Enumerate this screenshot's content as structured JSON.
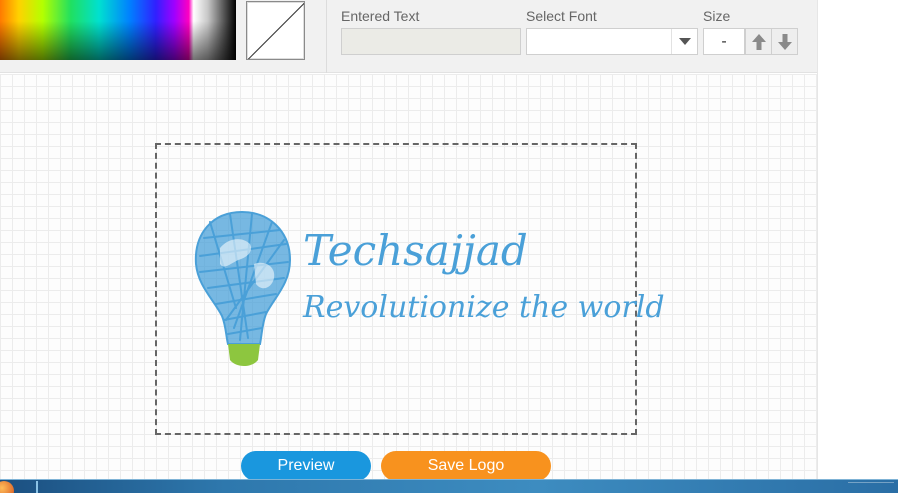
{
  "toolbar": {
    "entered_text_label": "Entered Text",
    "entered_text_value": "",
    "select_font_label": "Select Font",
    "select_font_value": "",
    "size_label": "Size",
    "size_value": "-"
  },
  "logo": {
    "title": "Techsajjad",
    "tagline": "Revolutionize the world",
    "text_color": "#4aa0d8",
    "bulb_color": "#4aa0d8",
    "bulb_base_color": "#8dc63f"
  },
  "buttons": {
    "preview_label": "Preview",
    "save_label": "Save Logo"
  },
  "colors": {
    "preview_button": "#1a97de",
    "save_button": "#f8921e"
  }
}
